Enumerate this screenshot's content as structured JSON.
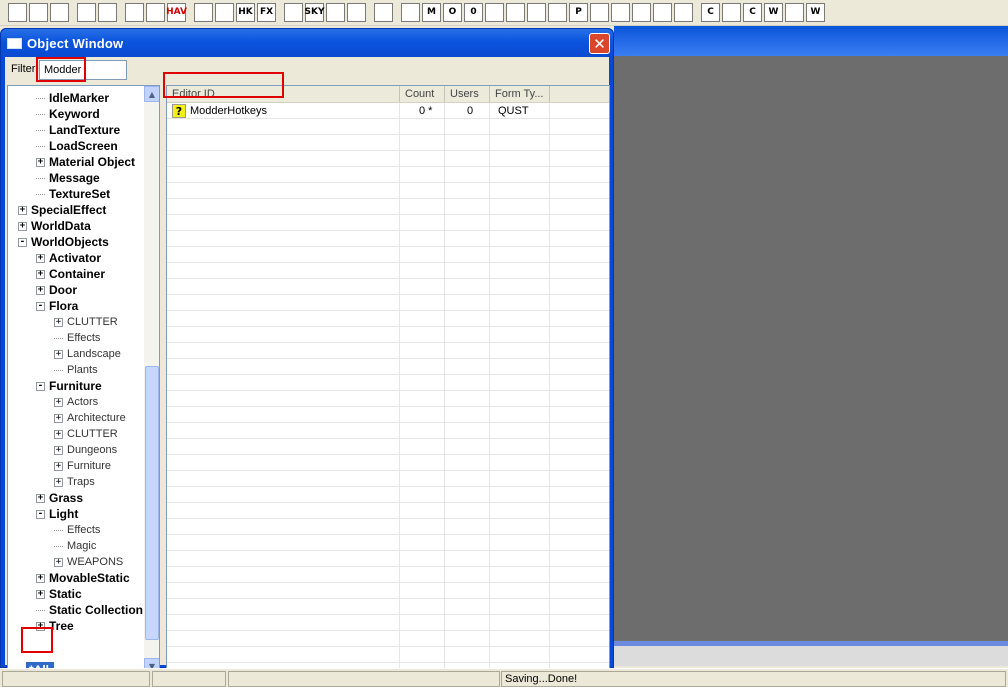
{
  "toolbar": {
    "icons": [
      "open-folder-icon",
      "save-icon",
      "save-all-icon",
      "undo-icon",
      "redo-icon",
      "render-window-icon",
      "landscape-edit-icon",
      "navmesh-icon",
      "world-icon",
      "heightmap-icon",
      "havok-icon",
      "effects-icon",
      "light-bulb-icon",
      "sky-icon",
      "grass-icon",
      "speech-bubble-icon",
      "marker-icon",
      "cube-icon",
      "m-cube-icon",
      "o-box-icon",
      "zero-box-icon",
      "rotate-cube-icon",
      "wire-cube-icon",
      "box-icon",
      "empty-box-icon",
      "p-box-icon",
      "red-box-icon",
      "x-box-icon",
      "link-icon",
      "arrow-icon",
      "cube-arrow-icon",
      "c-box-icon",
      "c-cube-icon",
      "c-circle-icon",
      "w-box-icon",
      "w-cube-icon",
      "w-circle-icon"
    ],
    "labels": [
      "",
      "",
      "",
      "",
      "",
      "",
      "",
      "HAV",
      "",
      "",
      "HK",
      "FX",
      "",
      "SKY",
      "",
      "",
      "",
      "",
      "M",
      "O",
      "0",
      "",
      "",
      "",
      "",
      "P",
      "",
      "",
      "",
      "",
      "",
      "C",
      "",
      "C",
      "W",
      "",
      "W"
    ]
  },
  "object_window": {
    "title": "Object Window",
    "close_label": "✕",
    "filter_label": "Filter",
    "filter_value": "Modder",
    "tree": [
      {
        "label": "IdleMarker",
        "level": 1,
        "bold": true,
        "exp": ""
      },
      {
        "label": "Keyword",
        "level": 1,
        "bold": true,
        "exp": ""
      },
      {
        "label": "LandTexture",
        "level": 1,
        "bold": true,
        "exp": ""
      },
      {
        "label": "LoadScreen",
        "level": 1,
        "bold": true,
        "exp": ""
      },
      {
        "label": "Material Object",
        "level": 1,
        "bold": true,
        "exp": "+"
      },
      {
        "label": "Message",
        "level": 1,
        "bold": true,
        "exp": ""
      },
      {
        "label": "TextureSet",
        "level": 1,
        "bold": true,
        "exp": ""
      },
      {
        "label": "SpecialEffect",
        "level": 0,
        "bold": true,
        "exp": "+"
      },
      {
        "label": "WorldData",
        "level": 0,
        "bold": true,
        "exp": "+"
      },
      {
        "label": "WorldObjects",
        "level": 0,
        "bold": true,
        "exp": "-"
      },
      {
        "label": "Activator",
        "level": 1,
        "bold": true,
        "exp": "+"
      },
      {
        "label": "Container",
        "level": 1,
        "bold": true,
        "exp": "+"
      },
      {
        "label": "Door",
        "level": 1,
        "bold": true,
        "exp": "+"
      },
      {
        "label": "Flora",
        "level": 1,
        "bold": true,
        "exp": "-"
      },
      {
        "label": "CLUTTER",
        "level": 2,
        "bold": false,
        "exp": "+"
      },
      {
        "label": "Effects",
        "level": 2,
        "bold": false,
        "exp": ""
      },
      {
        "label": "Landscape",
        "level": 2,
        "bold": false,
        "exp": "+"
      },
      {
        "label": "Plants",
        "level": 2,
        "bold": false,
        "exp": ""
      },
      {
        "label": "Furniture",
        "level": 1,
        "bold": true,
        "exp": "-"
      },
      {
        "label": "Actors",
        "level": 2,
        "bold": false,
        "exp": "+"
      },
      {
        "label": "Architecture",
        "level": 2,
        "bold": false,
        "exp": "+"
      },
      {
        "label": "CLUTTER",
        "level": 2,
        "bold": false,
        "exp": "+"
      },
      {
        "label": "Dungeons",
        "level": 2,
        "bold": false,
        "exp": "+"
      },
      {
        "label": "Furniture",
        "level": 2,
        "bold": false,
        "exp": "+"
      },
      {
        "label": "Traps",
        "level": 2,
        "bold": false,
        "exp": "+"
      },
      {
        "label": "Grass",
        "level": 1,
        "bold": true,
        "exp": "+"
      },
      {
        "label": "Light",
        "level": 1,
        "bold": true,
        "exp": "-"
      },
      {
        "label": "Effects",
        "level": 2,
        "bold": false,
        "exp": ""
      },
      {
        "label": "Magic",
        "level": 2,
        "bold": false,
        "exp": ""
      },
      {
        "label": "WEAPONS",
        "level": 2,
        "bold": false,
        "exp": "+"
      },
      {
        "label": "MovableStatic",
        "level": 1,
        "bold": true,
        "exp": "+"
      },
      {
        "label": "Static",
        "level": 1,
        "bold": true,
        "exp": "+"
      },
      {
        "label": "Static Collection",
        "level": 1,
        "bold": true,
        "exp": ""
      },
      {
        "label": "Tree",
        "level": 1,
        "bold": true,
        "exp": "+"
      }
    ],
    "all_item": "*All",
    "columns": [
      "Editor ID",
      "Count",
      "Users",
      "Form Ty..."
    ],
    "rows": [
      {
        "editor_id": "ModderHotkeys",
        "count": "0 *",
        "users": "0",
        "form_type": "QUST"
      }
    ]
  },
  "statusbar": {
    "message": "Saving...Done!"
  }
}
